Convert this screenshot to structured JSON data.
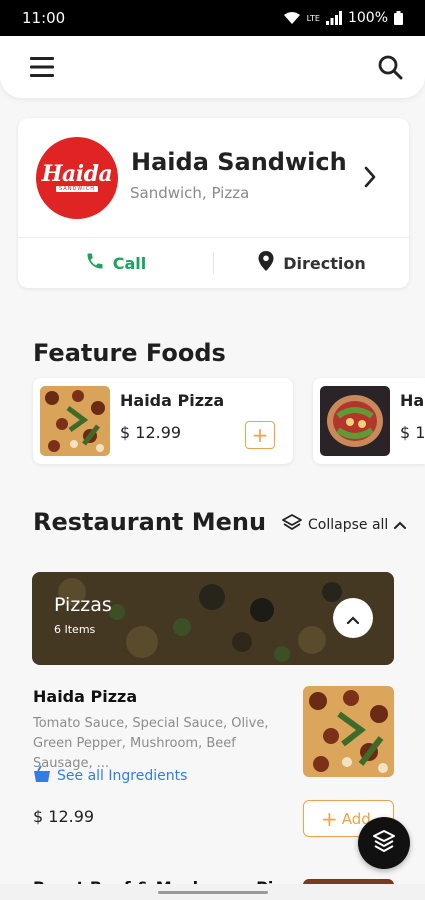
{
  "status_bar": {
    "time": "11:00",
    "network": "LTE",
    "battery": "100%",
    "icons": [
      "wifi-icon",
      "signal-icon",
      "battery-icon"
    ]
  },
  "app_bar": {
    "icons": [
      "menu-icon",
      "search-icon"
    ]
  },
  "restaurant": {
    "logo_text": "Haida",
    "logo_subtext": "SANDWICH",
    "name": "Haida Sandwich",
    "categories": "Sandwich, Pizza",
    "call_label": "Call",
    "direction_label": "Direction",
    "colors": {
      "logo_bg": "#e02424",
      "call": "#1aa45c"
    }
  },
  "featured": {
    "title": "Feature Foods",
    "items": [
      {
        "name": "Haida Pizza",
        "price": "$ 12.99",
        "add_icon": "+"
      },
      {
        "name": "Hai",
        "price": "$ 1"
      }
    ]
  },
  "menu": {
    "title": "Restaurant Menu",
    "collapse_label": "Collapse all",
    "category": {
      "title": "Pizzas",
      "count": "6 Items"
    },
    "items": [
      {
        "name": "Haida Pizza",
        "description": "Tomato Sauce, Special Sauce, Olive, Green Pepper, Mushroom, Beef Sausage, ...",
        "ingredients_link": "See all Ingredients",
        "price": "$ 12.99",
        "add_label": "Add",
        "add_icon": "+"
      }
    ],
    "next_item_partial": "Roast Beef & Mushroom Pizza"
  },
  "accent_color": "#f0a24a",
  "link_color": "#2f7ee8"
}
